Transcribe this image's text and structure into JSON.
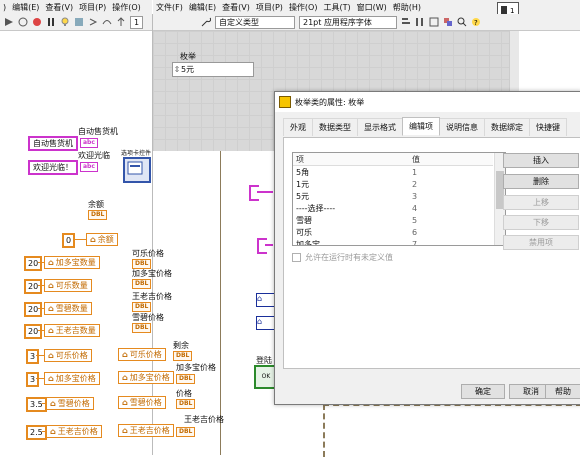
{
  "menu": {
    "left": [
      "编辑(E)",
      "查看(V)",
      "项目(P)",
      "操作(O)"
    ],
    "right": [
      "文件(F)",
      "编辑(E)",
      "查看(V)",
      "项目(P)",
      "操作(O)",
      "工具(T)",
      "窗口(W)",
      "帮助(H)"
    ],
    "left_prefix": ")"
  },
  "toolbar": {
    "type_select": "自定义类型",
    "font_select": "21pt 应用程序字体",
    "run_count": "1"
  },
  "front_panel": {
    "enum_label": "枚举",
    "enum_value": "5元"
  },
  "block": {
    "vending_label": "自动售货机",
    "vending_const": "自动售货机",
    "welcome_label": "欢迎光临",
    "welcome_const": "欢迎光临！",
    "tab_control_label": "选项卡控件",
    "balance_label": "余额",
    "zero_const": "0",
    "balance_node": "余额",
    "cola_price_label": "可乐价格",
    "jdb_price_label": "加多宝价格",
    "wlj_price_label": "王老吉价格",
    "snow_price_label": "雪碧价格",
    "rem_label": "剩余",
    "jdb_price_label2": "加多宝价格",
    "price_label": "价格",
    "wlj_price_label2": "王老吉价格",
    "dbl": "DBL",
    "abc": "abc",
    "rows_qty": [
      {
        "value": "20",
        "name": "加多宝数量"
      },
      {
        "value": "20",
        "name": "可乐数量"
      },
      {
        "value": "20",
        "name": "雪碧数量"
      },
      {
        "value": "20",
        "name": "王老吉数量"
      }
    ],
    "rows_price": [
      {
        "value": "3",
        "name": "可乐价格",
        "out": "可乐价格"
      },
      {
        "value": "3",
        "name": "加多宝价格",
        "out": "加多宝价格"
      },
      {
        "value": "3.5",
        "name": "雪碧价格",
        "out": "雪碧价格"
      },
      {
        "value": "2.5",
        "name": "王老吉价格",
        "out": "王老吉价格"
      }
    ],
    "right_labels": {
      "inc": "登陆",
      "ok": "OK"
    }
  },
  "dialog": {
    "title": "枚举类的属性: 枚举",
    "tabs": [
      "外观",
      "数据类型",
      "显示格式",
      "编辑项",
      "说明信息",
      "数据绑定",
      "快捷键"
    ],
    "active_tab": "编辑项",
    "col_item": "项",
    "col_value": "值",
    "items": [
      {
        "item": "5角",
        "value": "1"
      },
      {
        "item": "1元",
        "value": "2"
      },
      {
        "item": "5元",
        "value": "3"
      },
      {
        "item": "----选择----",
        "value": "4"
      },
      {
        "item": "雪碧",
        "value": "5"
      },
      {
        "item": "可乐",
        "value": "6"
      },
      {
        "item": "加多宝",
        "value": "7"
      }
    ],
    "buttons": {
      "insert": "插入",
      "delete": "删除",
      "up": "上移",
      "down": "下移",
      "disable": "禁用项"
    },
    "checkbox_label": "允许在运行时有未定义值",
    "ok": "确定",
    "cancel": "取消",
    "help": "帮助"
  }
}
